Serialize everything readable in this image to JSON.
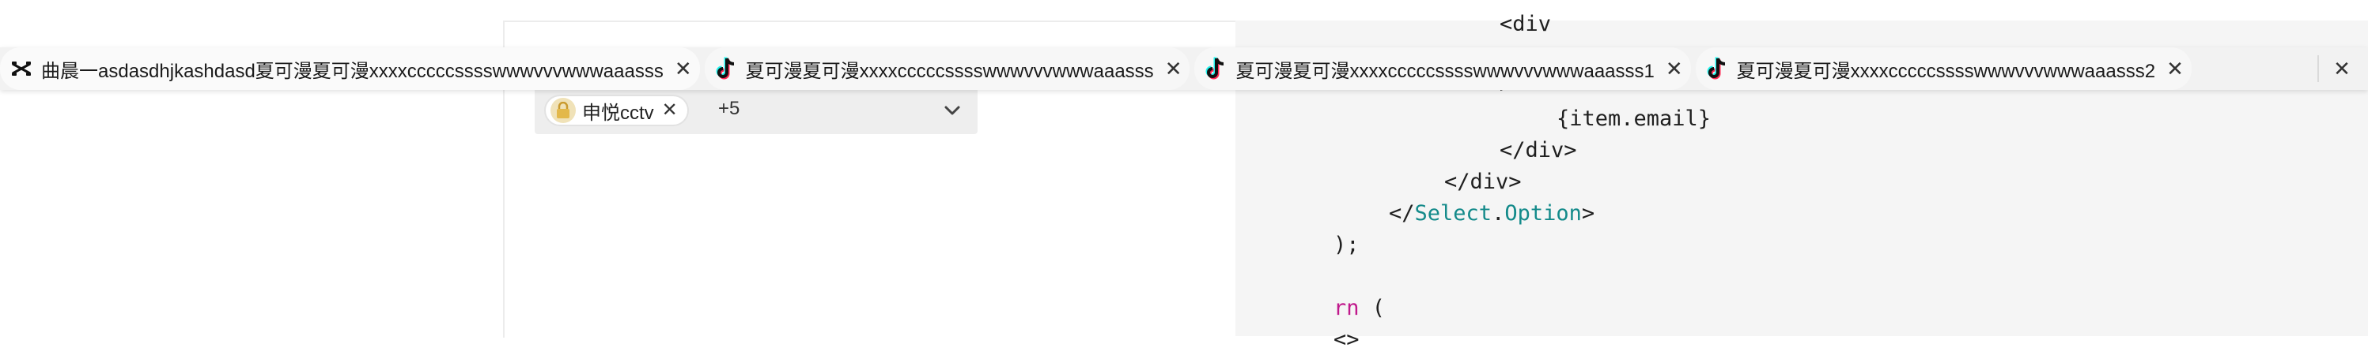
{
  "tabs": [
    {
      "icon": "capcut-icon",
      "label": "曲晨一asdasdhjkashdasd夏可漫夏可漫xxxxcccccsssswwwvvvwwwaaasss"
    },
    {
      "icon": "tiktok-icon",
      "label": "夏可漫夏可漫xxxxcccccsssswwwvvvwwwaaasss"
    },
    {
      "icon": "tiktok-icon",
      "label": "夏可漫夏可漫xxxxcccccsssswwwvvvwwwaaasss1"
    },
    {
      "icon": "tiktok-icon",
      "label": "夏可漫夏可漫xxxxcccccsssswwwvvvwwwaaasss2"
    }
  ],
  "select": {
    "tag_label": "申悦cctv",
    "more_count": "+5"
  },
  "code": {
    "line_top": "<div",
    "line_brace": ">",
    "line_email": "{item.email}",
    "line_div1": "</div>",
    "line_div2": "</div>",
    "line_option_open": "</",
    "line_option_select": "Select",
    "line_option_dot": ".",
    "line_option_option": "Option",
    "line_option_close": ">",
    "line_paren": ");",
    "line_return_kw": "rn",
    "line_return_paren": "(",
    "line_bottom": "<>"
  },
  "colors": {
    "teal": "#138a8a",
    "keyword": "#c0198c"
  }
}
